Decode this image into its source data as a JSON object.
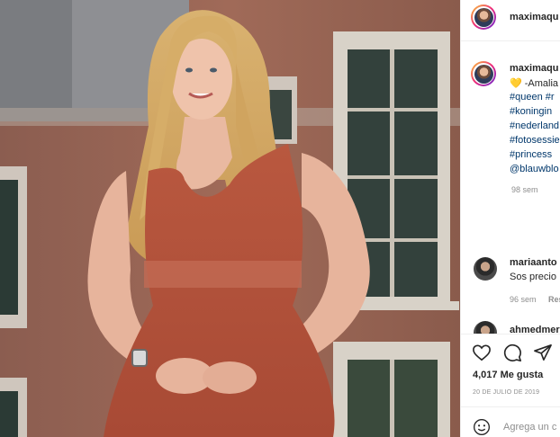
{
  "post": {
    "author": "maximaqueen",
    "author_visible": "maximaqu",
    "photo_alt": "photo"
  },
  "caption": {
    "username": "maximaqueen",
    "username_visible": "maximaqu",
    "heart_emoji": "💛",
    "text_visible": "-Amalia",
    "hashtags_visible": [
      "#queen #r",
      "#koningin",
      "#nederland",
      "#fotosessie",
      "#princess",
      "@blauwblo"
    ],
    "time": "98 sem"
  },
  "comments": [
    {
      "username_visible": "mariaanto",
      "text_visible": "Sos precio",
      "time": "96 sem",
      "reply_visible": "Res"
    },
    {
      "username_visible": "ahmedmer"
    }
  ],
  "actions": {
    "like_icon": "heart-icon",
    "comment_icon": "comment-icon",
    "share_icon": "share-icon",
    "likes": "4,017 Me gusta",
    "date": "20 DE JULIO DE 2019"
  },
  "add_comment": {
    "emoji_icon": "smiley-icon",
    "placeholder_visible": "Agrega un c"
  },
  "colors": {
    "link": "#00376b",
    "text": "#262626",
    "muted": "#8e8e8e",
    "dress": "#b8553f"
  }
}
